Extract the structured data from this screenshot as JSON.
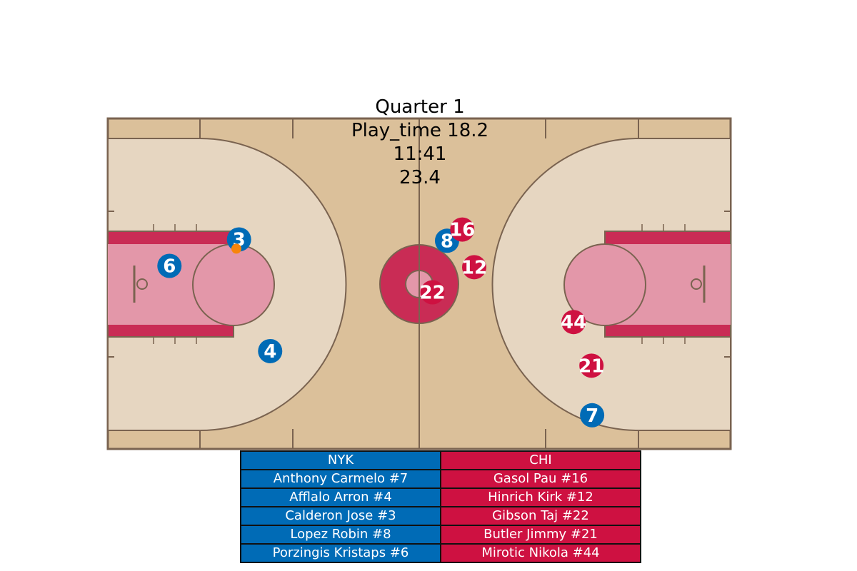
{
  "header": {
    "quarter": "Quarter 1",
    "play_time": "Play_time 18.2",
    "game_clock": "11:41",
    "shot_clock": "23.4"
  },
  "colors": {
    "home": "#006bb6",
    "away": "#ce1141",
    "ball": "#f7850c",
    "court_wood": "#dbc09a",
    "court_light": "#e6d6c1",
    "paint": "#e397a9",
    "paint_border": "#c92c55",
    "lines": "#7a6350"
  },
  "teams": {
    "home": {
      "abbr": "NYK",
      "roster": [
        "Anthony Carmelo #7",
        "Afflalo Arron #4",
        "Calderon Jose #3",
        "Lopez Robin #8",
        "Porzingis Kristaps #6"
      ]
    },
    "away": {
      "abbr": "CHI",
      "roster": [
        "Gasol Pau #16",
        "Hinrich Kirk #12",
        "Gibson Taj #22",
        "Butler Jimmy #21",
        "Mirotic Nikola #44"
      ]
    }
  },
  "players": {
    "home": [
      {
        "number": "3",
        "x": 19.8,
        "y": 18.3
      },
      {
        "number": "6",
        "x": 9.3,
        "y": 22.3
      },
      {
        "number": "4",
        "x": 24.5,
        "y": 35.2
      },
      {
        "number": "8",
        "x": 51.2,
        "y": 18.5
      },
      {
        "number": "7",
        "x": 73.1,
        "y": 44.9
      }
    ],
    "away": [
      {
        "number": "16",
        "x": 53.5,
        "y": 16.8
      },
      {
        "number": "12",
        "x": 55.3,
        "y": 22.5
      },
      {
        "number": "22",
        "x": 49.0,
        "y": 26.3
      },
      {
        "number": "44",
        "x": 70.3,
        "y": 30.8
      },
      {
        "number": "21",
        "x": 73.0,
        "y": 37.4
      }
    ]
  },
  "ball": {
    "x": 19.4,
    "y": 19.7
  }
}
